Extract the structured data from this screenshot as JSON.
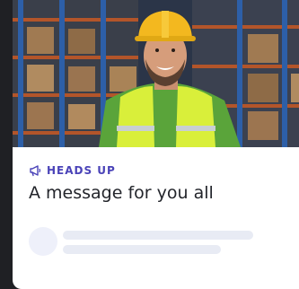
{
  "card": {
    "hero_image_alt": "Warehouse worker in hard hat and safety vest",
    "category_icon": "megaphone-icon",
    "category_label": "HEADS UP",
    "message": "A message for you all",
    "accent_color": "#4a43b8"
  }
}
